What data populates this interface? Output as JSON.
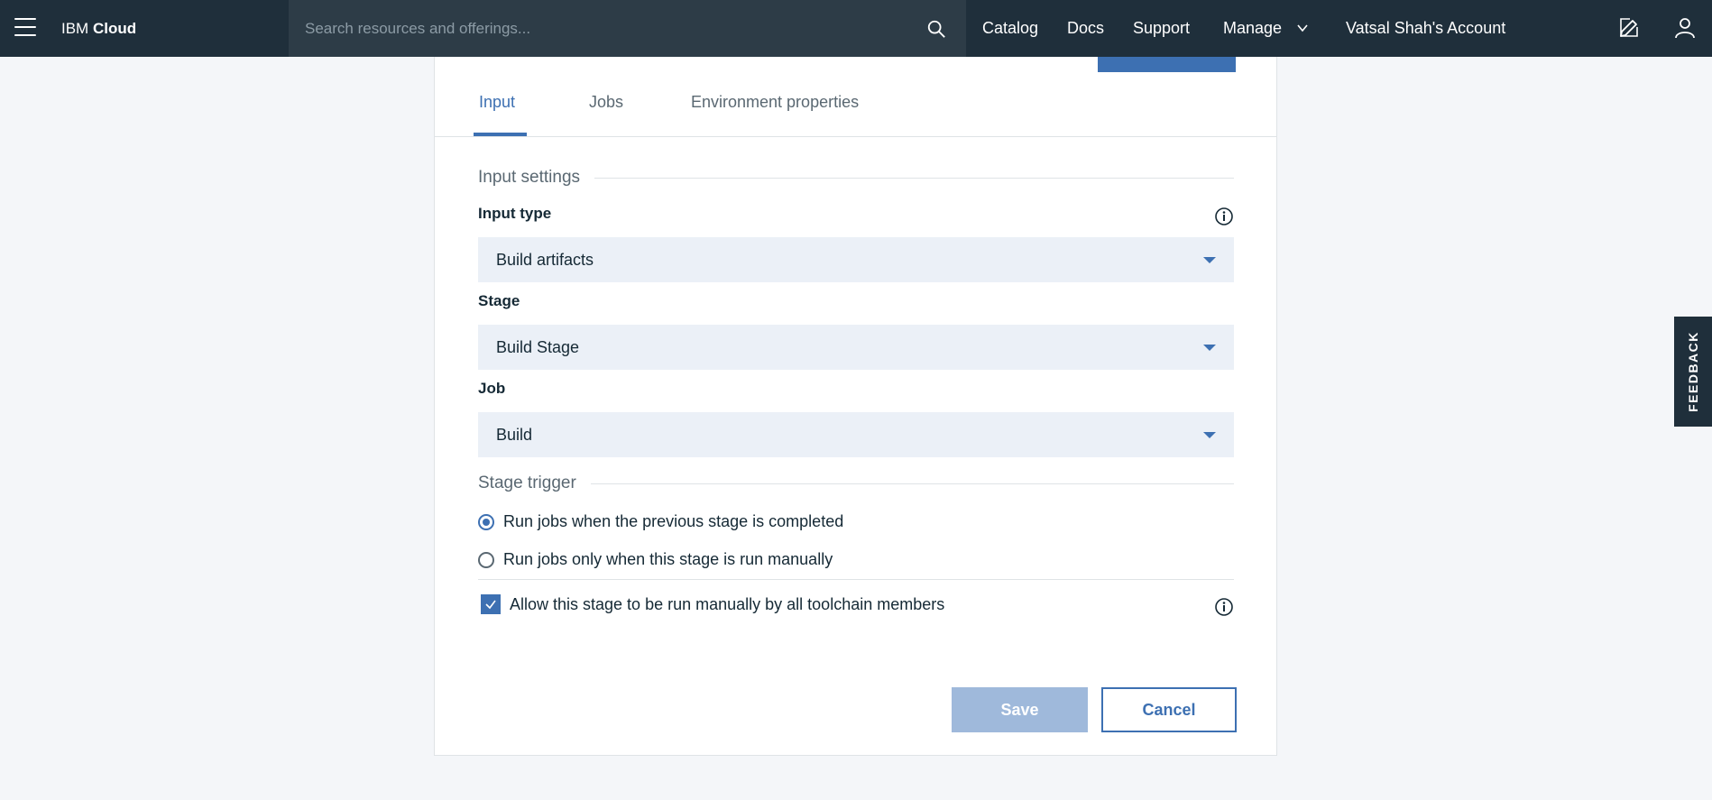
{
  "topbar": {
    "brand_prefix": "IBM",
    "brand_suffix": "Cloud",
    "search_placeholder": "Search resources and offerings...",
    "nav": {
      "catalog": "Catalog",
      "docs": "Docs",
      "support": "Support",
      "manage": "Manage",
      "account": "Vatsal Shah's Account"
    }
  },
  "tabs": [
    {
      "label": "Input",
      "active": true
    },
    {
      "label": "Jobs",
      "active": false
    },
    {
      "label": "Environment properties",
      "active": false
    }
  ],
  "input_settings": {
    "title": "Input settings",
    "input_type": {
      "label": "Input type",
      "value": "Build artifacts"
    },
    "stage": {
      "label": "Stage",
      "value": "Build Stage"
    },
    "job": {
      "label": "Job",
      "value": "Build"
    }
  },
  "stage_trigger": {
    "title": "Stage trigger",
    "options": [
      {
        "label": "Run jobs when the previous stage is completed",
        "checked": true
      },
      {
        "label": "Run jobs only when this stage is run manually",
        "checked": false
      }
    ],
    "allow_manual": {
      "label": "Allow this stage to be run manually by all toolchain members",
      "checked": true
    }
  },
  "actions": {
    "save": "Save",
    "cancel": "Cancel"
  },
  "feedback": "FEEDBACK",
  "colors": {
    "topbar": "#1f2f3b",
    "accent": "#3d70b2",
    "select_bg": "#ebf0f7",
    "save_disabled": "#9fb9db"
  }
}
